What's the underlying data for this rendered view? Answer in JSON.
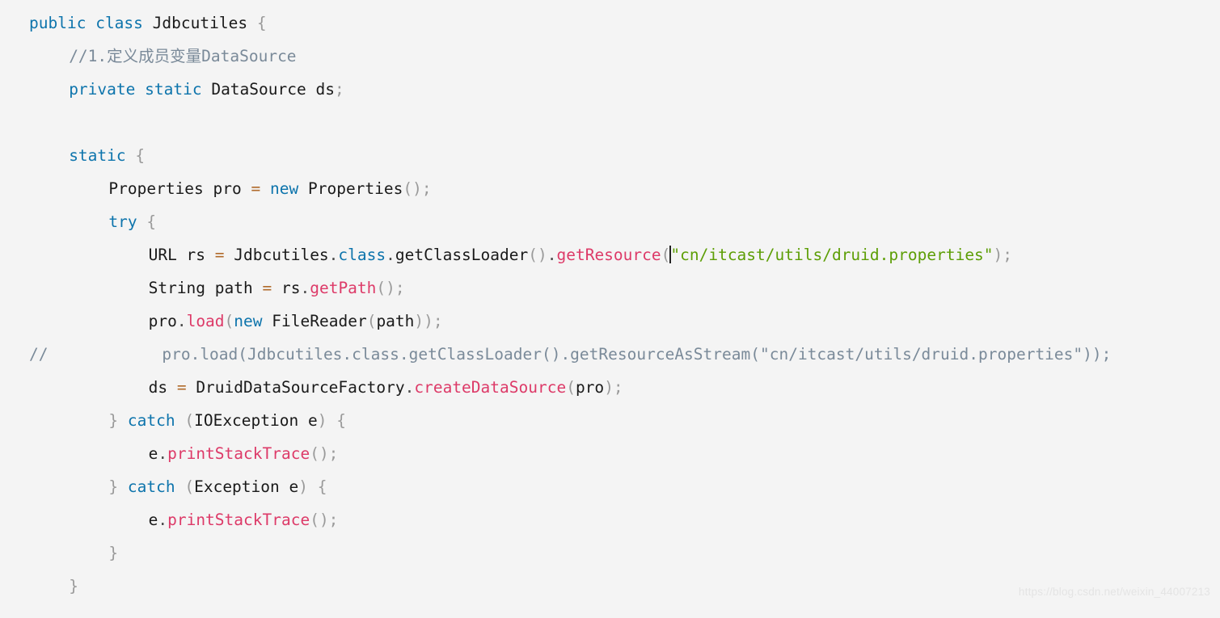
{
  "editor": {
    "background_color": "#f4f4f4",
    "language": "java",
    "theme_colors": {
      "keyword": "#0d74ac",
      "plain_text": "#1a1a1a",
      "punctuation": "#9a9a9a",
      "method_call": "#dd3a68",
      "string": "#5d9e06",
      "comment": "#7a8a99",
      "operator": "#b06a2a",
      "caret": "#222222"
    },
    "caret": {
      "present": true,
      "line_index": 7,
      "after_text": "getResource("
    }
  },
  "watermark": {
    "text": "https://blog.csdn.net/weixin_44007213"
  },
  "code": {
    "lines": [
      {
        "indent": 0,
        "tokens": [
          {
            "t": "public",
            "c": "kw"
          },
          {
            "t": " ",
            "c": "plain"
          },
          {
            "t": "class",
            "c": "kw"
          },
          {
            "t": " ",
            "c": "plain"
          },
          {
            "t": "Jdbcutiles",
            "c": "plain"
          },
          {
            "t": " ",
            "c": "plain"
          },
          {
            "t": "{",
            "c": "punct"
          }
        ]
      },
      {
        "indent": 4,
        "tokens": [
          {
            "t": "//1.定义成员变量DataSource",
            "c": "comment"
          }
        ]
      },
      {
        "indent": 4,
        "tokens": [
          {
            "t": "private",
            "c": "kw"
          },
          {
            "t": " ",
            "c": "plain"
          },
          {
            "t": "static",
            "c": "kw"
          },
          {
            "t": " ",
            "c": "plain"
          },
          {
            "t": "DataSource ds",
            "c": "plain"
          },
          {
            "t": ";",
            "c": "semi"
          }
        ]
      },
      {
        "indent": 0,
        "tokens": []
      },
      {
        "indent": 4,
        "tokens": [
          {
            "t": "static",
            "c": "kw"
          },
          {
            "t": " ",
            "c": "plain"
          },
          {
            "t": "{",
            "c": "punct"
          }
        ]
      },
      {
        "indent": 8,
        "tokens": [
          {
            "t": "Properties pro ",
            "c": "plain"
          },
          {
            "t": "=",
            "c": "op"
          },
          {
            "t": " ",
            "c": "plain"
          },
          {
            "t": "new",
            "c": "kw"
          },
          {
            "t": " ",
            "c": "plain"
          },
          {
            "t": "Properties",
            "c": "plain"
          },
          {
            "t": "();",
            "c": "punct"
          }
        ]
      },
      {
        "indent": 8,
        "tokens": [
          {
            "t": "try",
            "c": "kw"
          },
          {
            "t": " ",
            "c": "plain"
          },
          {
            "t": "{",
            "c": "punct"
          }
        ]
      },
      {
        "indent": 12,
        "tokens": [
          {
            "t": "URL rs ",
            "c": "plain"
          },
          {
            "t": "=",
            "c": "op"
          },
          {
            "t": " Jdbcutiles",
            "c": "plain"
          },
          {
            "t": ".",
            "c": "dot"
          },
          {
            "t": "class",
            "c": "kw"
          },
          {
            "t": ".",
            "c": "dot"
          },
          {
            "t": "getClassLoader",
            "c": "plain"
          },
          {
            "t": "()",
            "c": "punct"
          },
          {
            "t": ".",
            "c": "dot"
          },
          {
            "t": "getResource",
            "c": "method"
          },
          {
            "t": "(",
            "c": "punct"
          },
          {
            "t": "",
            "c": "caret"
          },
          {
            "t": "\"cn/itcast/utils/druid.properties\"",
            "c": "str"
          },
          {
            "t": ");",
            "c": "punct"
          }
        ]
      },
      {
        "indent": 12,
        "tokens": [
          {
            "t": "String path ",
            "c": "plain"
          },
          {
            "t": "=",
            "c": "op"
          },
          {
            "t": " rs",
            "c": "plain"
          },
          {
            "t": ".",
            "c": "dot"
          },
          {
            "t": "getPath",
            "c": "method"
          },
          {
            "t": "();",
            "c": "punct"
          }
        ]
      },
      {
        "indent": 12,
        "tokens": [
          {
            "t": "pro",
            "c": "plain"
          },
          {
            "t": ".",
            "c": "dot"
          },
          {
            "t": "load",
            "c": "method"
          },
          {
            "t": "(",
            "c": "punct"
          },
          {
            "t": "new",
            "c": "kw"
          },
          {
            "t": " ",
            "c": "plain"
          },
          {
            "t": "FileReader",
            "c": "plain"
          },
          {
            "t": "(",
            "c": "punct"
          },
          {
            "t": "path",
            "c": "plain"
          },
          {
            "t": "));",
            "c": "punct"
          }
        ]
      },
      {
        "indent": 0,
        "tokens": [
          {
            "t": "//            pro.load(Jdbcutiles.class.getClassLoader().getResourceAsStream(\"cn/itcast/utils/druid.properties\"));",
            "c": "comment"
          }
        ]
      },
      {
        "indent": 12,
        "tokens": [
          {
            "t": "ds ",
            "c": "plain"
          },
          {
            "t": "=",
            "c": "op"
          },
          {
            "t": " DruidDataSourceFactory",
            "c": "plain"
          },
          {
            "t": ".",
            "c": "dot"
          },
          {
            "t": "createDataSource",
            "c": "method"
          },
          {
            "t": "(",
            "c": "punct"
          },
          {
            "t": "pro",
            "c": "plain"
          },
          {
            "t": ");",
            "c": "punct"
          }
        ]
      },
      {
        "indent": 8,
        "tokens": [
          {
            "t": "}",
            "c": "punct"
          },
          {
            "t": " ",
            "c": "plain"
          },
          {
            "t": "catch",
            "c": "kw"
          },
          {
            "t": " ",
            "c": "plain"
          },
          {
            "t": "(",
            "c": "punct"
          },
          {
            "t": "IOException e",
            "c": "plain"
          },
          {
            "t": ")",
            "c": "punct"
          },
          {
            "t": " ",
            "c": "plain"
          },
          {
            "t": "{",
            "c": "punct"
          }
        ]
      },
      {
        "indent": 12,
        "tokens": [
          {
            "t": "e",
            "c": "plain"
          },
          {
            "t": ".",
            "c": "dot"
          },
          {
            "t": "printStackTrace",
            "c": "method"
          },
          {
            "t": "();",
            "c": "punct"
          }
        ]
      },
      {
        "indent": 8,
        "tokens": [
          {
            "t": "}",
            "c": "punct"
          },
          {
            "t": " ",
            "c": "plain"
          },
          {
            "t": "catch",
            "c": "kw"
          },
          {
            "t": " ",
            "c": "plain"
          },
          {
            "t": "(",
            "c": "punct"
          },
          {
            "t": "Exception e",
            "c": "plain"
          },
          {
            "t": ")",
            "c": "punct"
          },
          {
            "t": " ",
            "c": "plain"
          },
          {
            "t": "{",
            "c": "punct"
          }
        ]
      },
      {
        "indent": 12,
        "tokens": [
          {
            "t": "e",
            "c": "plain"
          },
          {
            "t": ".",
            "c": "dot"
          },
          {
            "t": "printStackTrace",
            "c": "method"
          },
          {
            "t": "();",
            "c": "punct"
          }
        ]
      },
      {
        "indent": 8,
        "tokens": [
          {
            "t": "}",
            "c": "punct"
          }
        ]
      },
      {
        "indent": 4,
        "tokens": [
          {
            "t": "}",
            "c": "punct"
          }
        ]
      }
    ]
  }
}
